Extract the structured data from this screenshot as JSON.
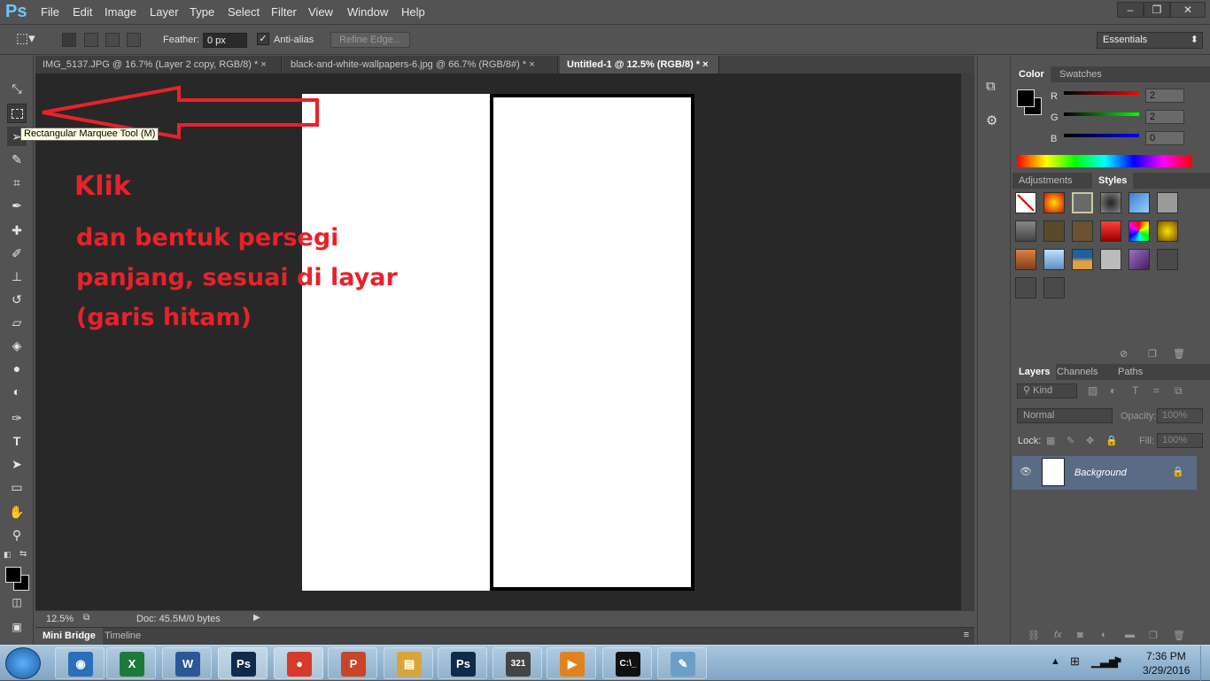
{
  "app": {
    "logo": "Ps"
  },
  "menu": [
    "File",
    "Edit",
    "Image",
    "Layer",
    "Type",
    "Select",
    "Filter",
    "View",
    "Window",
    "Help"
  ],
  "window_controls": {
    "minimize": "–",
    "restore": "❐",
    "close": "✕"
  },
  "options": {
    "feather_label": "Feather:",
    "feather_value": "0 px",
    "antialias_label": "Anti-alias",
    "antialias_checked": true,
    "refine_edge": "Refine Edge...",
    "workspace": "Essentials"
  },
  "tabs": [
    {
      "label": "IMG_5137.JPG @ 16.7% (Layer 2 copy, RGB/8) *",
      "active": false
    },
    {
      "label": "black-and-white-wallpapers-6.jpg @ 66.7% (RGB/8#) *",
      "active": false
    },
    {
      "label": "Untitled-1 @ 12.5% (RGB/8) *",
      "active": true
    }
  ],
  "tab_close": "×",
  "tooltip": "Rectangular Marquee Tool (M)",
  "annotation": {
    "click": "Klik",
    "line1": "dan bentuk persegi",
    "line2": "panjang, sesuai di layar",
    "line3": "(garis hitam)",
    "color": "#e8222a"
  },
  "status": {
    "zoom": "12.5%",
    "doc": "Doc: 45.5M/0 bytes"
  },
  "bottom_tabs": {
    "mini_bridge": "Mini Bridge",
    "timeline": "Timeline"
  },
  "color_panel": {
    "tabs": [
      "Color",
      "Swatches"
    ],
    "r_label": "R",
    "g_label": "G",
    "b_label": "B",
    "r": "2",
    "g": "2",
    "b": "0"
  },
  "adjust_panel": {
    "tabs": [
      "Adjustments",
      "Styles"
    ]
  },
  "layers_panel": {
    "tabs": [
      "Layers",
      "Channels",
      "Paths"
    ],
    "kind": "Kind",
    "blend_mode": "Normal",
    "opacity_label": "Opacity:",
    "opacity": "100%",
    "lock_label": "Lock:",
    "fill_label": "Fill:",
    "fill": "100%",
    "layer_name": "Background"
  },
  "taskbar": {
    "time": "7:36 PM",
    "date": "3/29/2016",
    "apps": [
      {
        "name": "webcam",
        "glyph": "◉",
        "color": "#2a6fb8"
      },
      {
        "name": "excel",
        "glyph": "X",
        "color": "#1d7a3a"
      },
      {
        "name": "word",
        "glyph": "W",
        "color": "#2b5797"
      },
      {
        "name": "photoshop",
        "glyph": "Ps",
        "color": "#0f2a4a"
      },
      {
        "name": "chrome",
        "glyph": "●",
        "color": "#d63a2a"
      },
      {
        "name": "powerpoint",
        "glyph": "P",
        "color": "#c8452a"
      },
      {
        "name": "explorer",
        "glyph": "▤",
        "color": "#d9a53a"
      },
      {
        "name": "photoshop-2",
        "glyph": "Ps",
        "color": "#0f2a4a"
      },
      {
        "name": "media-player",
        "glyph": "321",
        "color": "#444444"
      },
      {
        "name": "video",
        "glyph": "▶",
        "color": "#e0831f"
      },
      {
        "name": "cmd",
        "glyph": "C:\\_",
        "color": "#111111"
      },
      {
        "name": "paint",
        "glyph": "✎",
        "color": "#6aa0c8"
      }
    ]
  }
}
